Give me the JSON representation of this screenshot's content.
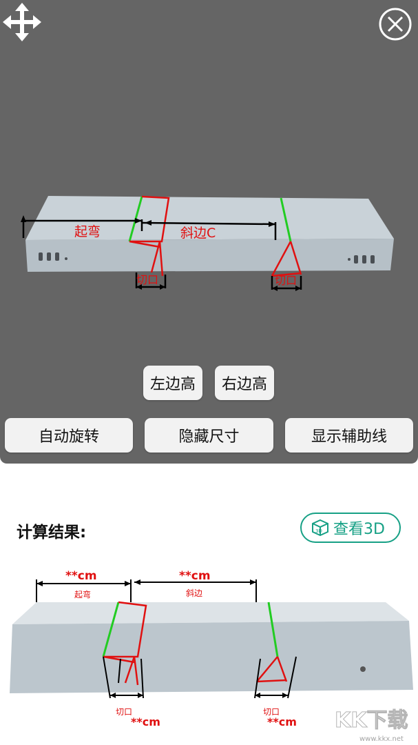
{
  "viewer": {
    "model_labels": {
      "bend": "起弯",
      "bevel_c": "斜边C",
      "cut_left": "切口",
      "cut_right": "切口"
    },
    "buttons": {
      "left_height": "左边高",
      "right_height": "右边高",
      "auto_rotate": "自动旋转",
      "hide_size": "隐藏尺寸",
      "show_guides": "显示辅助线"
    }
  },
  "results": {
    "title": "计算结果:",
    "view3d_label": "查看3D",
    "diagram": {
      "bend_value": "**cm",
      "bend_label": "起弯",
      "bevel_value": "**cm",
      "bevel_label": "斜边",
      "cut_left_label": "切口",
      "cut_left_value": "**cm",
      "cut_right_label": "切口",
      "cut_right_value": "**cm"
    }
  },
  "watermark": {
    "brand": "KK下载",
    "url": "www.kkx.net"
  },
  "colors": {
    "viewer_bg": "#656565",
    "accent": "#16a085",
    "red": "#e01010",
    "green": "#22cc22"
  }
}
